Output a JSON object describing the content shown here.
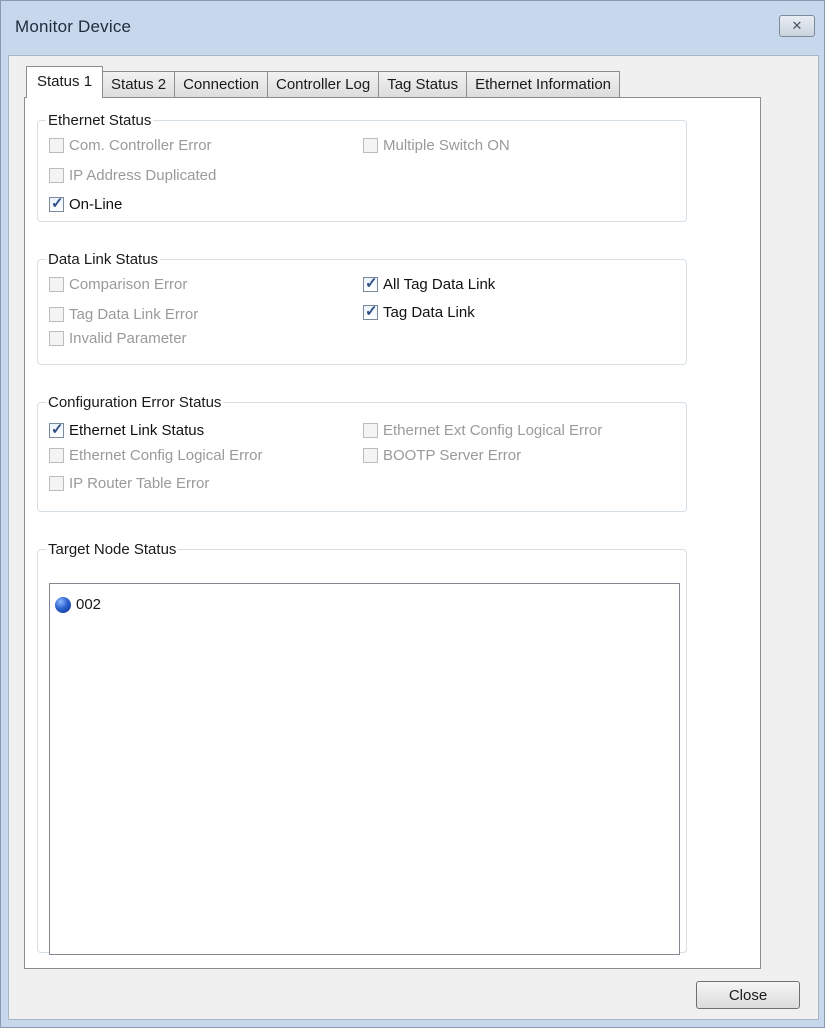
{
  "window": {
    "title": "Monitor Device",
    "close_glyph": "✕"
  },
  "tabs": [
    "Status 1",
    "Status 2",
    "Connection",
    "Controller Log",
    "Tag Status",
    "Ethernet Information"
  ],
  "ethernet_status": {
    "label": "Ethernet Status",
    "items": [
      {
        "label": "Com. Controller Error",
        "checked": false,
        "enabled": false
      },
      {
        "label": "IP Address Duplicated",
        "checked": false,
        "enabled": false
      },
      {
        "label": "On-Line",
        "checked": true,
        "enabled": true
      },
      {
        "label": "Multiple Switch ON",
        "checked": false,
        "enabled": false
      }
    ]
  },
  "data_link_status": {
    "label": "Data Link Status",
    "items": [
      {
        "label": "Comparison Error",
        "checked": false,
        "enabled": false
      },
      {
        "label": "Tag Data Link Error",
        "checked": false,
        "enabled": false
      },
      {
        "label": "Invalid Parameter",
        "checked": false,
        "enabled": false
      },
      {
        "label": "All Tag Data Link",
        "checked": true,
        "enabled": true
      },
      {
        "label": "Tag Data Link",
        "checked": true,
        "enabled": true
      }
    ]
  },
  "config_error_status": {
    "label": "Configuration Error Status",
    "items": [
      {
        "label": "Ethernet Link Status",
        "checked": true,
        "enabled": true
      },
      {
        "label": "Ethernet Config Logical Error",
        "checked": false,
        "enabled": false
      },
      {
        "label": "IP Router Table Error",
        "checked": false,
        "enabled": false
      },
      {
        "label": "Ethernet Ext Config Logical Error",
        "checked": false,
        "enabled": false
      },
      {
        "label": "BOOTP Server Error",
        "checked": false,
        "enabled": false
      }
    ]
  },
  "target_node_status": {
    "label": "Target Node Status",
    "nodes": [
      {
        "id": "002",
        "icon": "blue-circle-icon",
        "color": "#2d63d0"
      }
    ]
  },
  "buttons": {
    "close": "Close"
  },
  "check_glyph": "✓"
}
